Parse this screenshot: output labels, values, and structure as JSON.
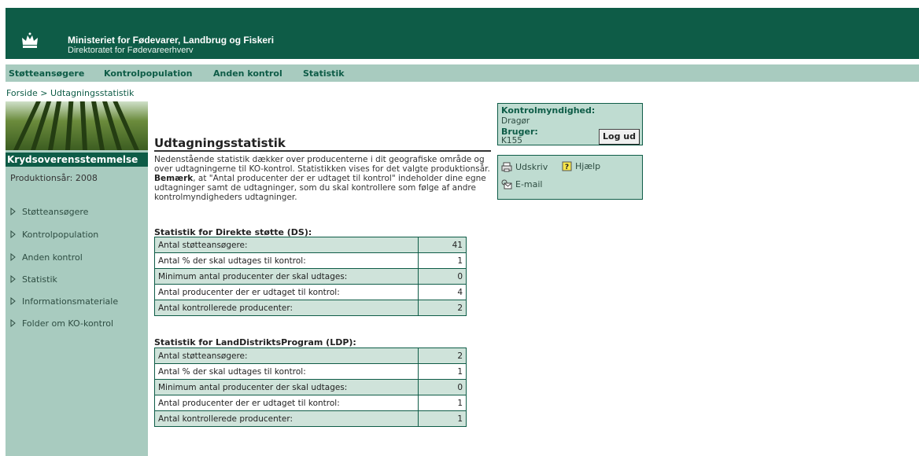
{
  "header": {
    "ministry": "Ministeriet for Fødevarer, Landbrug og Fiskeri",
    "directorate": "Direktoratet for Fødevareerhverv",
    "logo_icon": "crown-icon"
  },
  "topnav": [
    "Støtteansøgere",
    "Kontrolpopulation",
    "Anden kontrol",
    "Statistik"
  ],
  "breadcrumb": {
    "home": "Forside",
    "separator": ">",
    "current": "Udtagningsstatistik"
  },
  "sidebar": {
    "heading": "Krydsoverensstemmelse",
    "year_label": "Produktionsår: 2008",
    "items": [
      "Støtteansøgere",
      "Kontrolpopulation",
      "Anden kontrol",
      "Statistik",
      "Informationsmateriale",
      "Folder om KO-kontrol"
    ]
  },
  "main": {
    "title": "Udtagningsstatistik",
    "intro_1": "Nedenstående statistik dækker over producenterne i dit geografiske område og over udtagningerne til KO-kontrol. Statistikken vises for det valgte produktionsår.",
    "intro_bold": "Bemærk",
    "intro_2": ", at \"Antal producenter der er udtaget til kontrol\" indeholder dine egne udtagninger samt de udtagninger, som du skal kontrollere som følge af andre kontrolmyndigheders udtagninger.",
    "ds": {
      "heading": "Statistik for Direkte støtte (DS):",
      "rows": [
        {
          "label": "Antal støtteansøgere:",
          "value": "41"
        },
        {
          "label": "Antal % der skal udtages til kontrol:",
          "value": "1"
        },
        {
          "label": "Minimum antal producenter der skal udtages:",
          "value": "0"
        },
        {
          "label": "Antal producenter der er udtaget til kontrol:",
          "value": "4"
        },
        {
          "label": "Antal kontrollerede producenter:",
          "value": "2"
        }
      ]
    },
    "ldp": {
      "heading": "Statistik for LandDistriktsProgram (LDP):",
      "rows": [
        {
          "label": "Antal støtteansøgere:",
          "value": "2"
        },
        {
          "label": "Antal % der skal udtages til kontrol:",
          "value": "1"
        },
        {
          "label": "Minimum antal producenter der skal udtages:",
          "value": "0"
        },
        {
          "label": "Antal producenter der er udtaget til kontrol:",
          "value": "1"
        },
        {
          "label": "Antal kontrollerede producenter:",
          "value": "1"
        }
      ]
    }
  },
  "userbox": {
    "authority_label": "Kontrolmyndighed:",
    "authority_value": "Dragør",
    "user_label": "Bruger:",
    "user_value": "K155",
    "logout_label": "Log ud"
  },
  "tools": {
    "print": "Udskriv",
    "help": "Hjælp",
    "email": "E-mail"
  },
  "colors": {
    "brand": "#0e5c47",
    "nav_bg": "#a8cbbf",
    "row_alt": "#cfe3da"
  }
}
